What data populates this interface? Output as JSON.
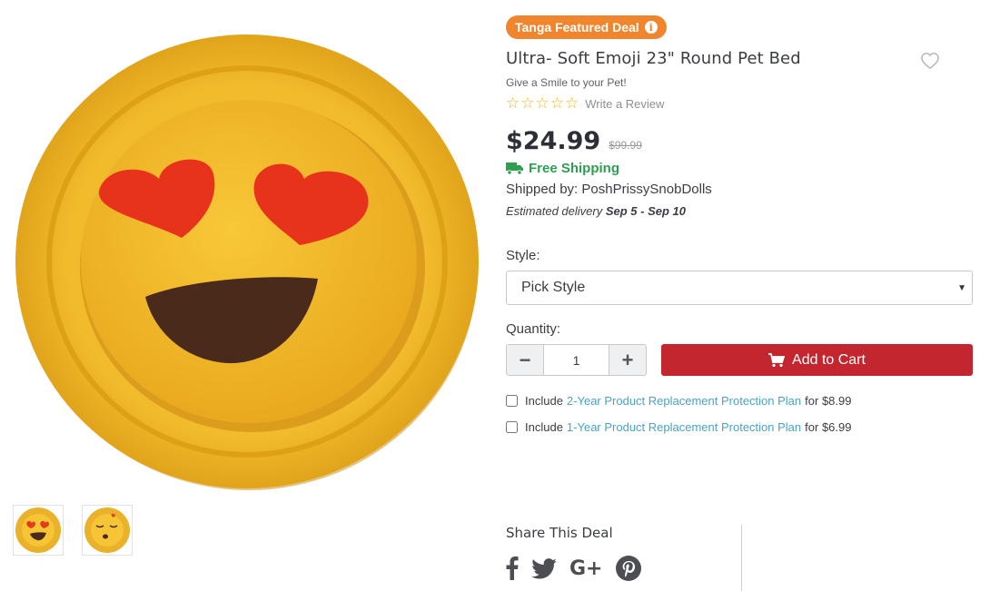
{
  "badge": {
    "label": "Tanga Featured Deal",
    "info_icon": "info-icon"
  },
  "product": {
    "title": "Ultra- Soft Emoji 23\" Round Pet Bed",
    "subtitle": "Give a Smile to your Pet!",
    "review_link": "Write a Review",
    "rating": 0,
    "price": "$24.99",
    "old_price": "$99.99",
    "shipping": "Free Shipping",
    "shipped_by": "Shipped by: PoshPrissySnobDolls",
    "delivery_prefix": "Estimated delivery",
    "delivery_range": "Sep 5 - Sep 10"
  },
  "style": {
    "label": "Style:",
    "selected": "Pick Style"
  },
  "quantity": {
    "label": "Quantity:",
    "value": "1",
    "minus": "−",
    "plus": "+"
  },
  "cart": {
    "label": "Add to Cart"
  },
  "plans": [
    {
      "prefix": "Include",
      "link": "2-Year Product Replacement Protection Plan",
      "suffix": "for $8.99"
    },
    {
      "prefix": "Include",
      "link": "1-Year Product Replacement Protection Plan",
      "suffix": "for $6.99"
    }
  ],
  "share": {
    "title": "Share This Deal",
    "icons": [
      "facebook-icon",
      "twitter-icon",
      "google-plus-icon",
      "pinterest-icon"
    ],
    "gplus_text": "G+"
  },
  "colors": {
    "badge": "#f0852d",
    "cart": "#c3262f",
    "shipping": "#2e9e4f",
    "link": "#4aa3c4",
    "star": "#e8b923"
  }
}
